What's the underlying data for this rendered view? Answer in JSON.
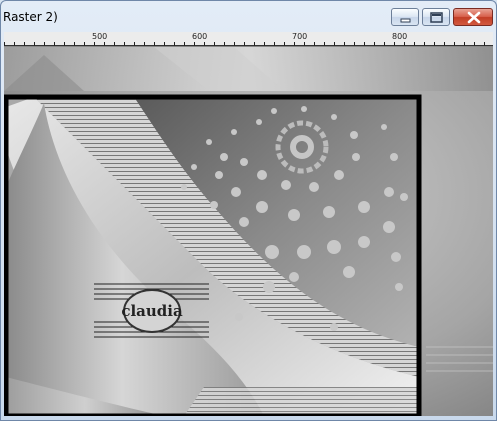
{
  "window": {
    "title": "Raster 2)"
  },
  "ruler": {
    "labels": [
      "500",
      "600",
      "700",
      "800"
    ]
  },
  "canvas": {
    "watermark_text": "claudia"
  },
  "colors": {
    "titlebar": "#dbe6f3",
    "close_button": "#c94f36",
    "canvas_gray": "#9c9c9c"
  },
  "icons": {
    "minimize": "minimize-icon",
    "maximize": "maximize-icon",
    "close": "close-icon"
  }
}
